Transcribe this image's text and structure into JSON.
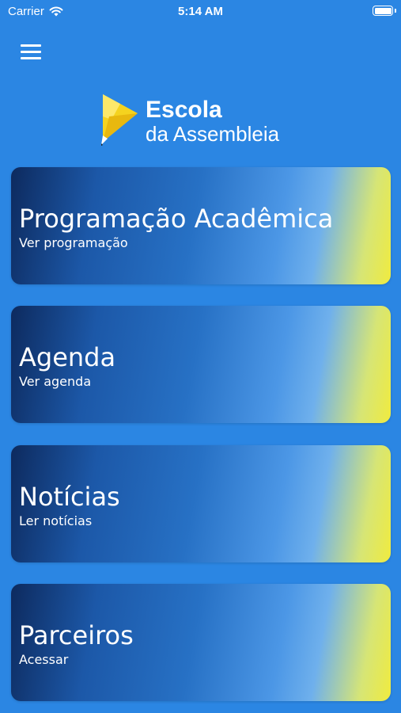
{
  "status_bar": {
    "carrier": "Carrier",
    "time": "5:14 AM",
    "battery_level": 1.0
  },
  "header": {
    "menu_icon": "hamburger-menu-icon"
  },
  "logo": {
    "line1": "Escola",
    "line2": "da Assembleia",
    "colors": {
      "mark_yellow": "#f5d31f",
      "mark_white": "#ffffff"
    }
  },
  "theme": {
    "background": "#2b86e3",
    "card_gradient_start": "#0d2a5e",
    "card_gradient_end": "#f0eb3f"
  },
  "cards": [
    {
      "title": "Programação Acadêmica",
      "subtitle": "Ver programação"
    },
    {
      "title": "Agenda",
      "subtitle": "Ver agenda"
    },
    {
      "title": "Notícias",
      "subtitle": "Ler notícias"
    },
    {
      "title": "Parceiros",
      "subtitle": "Acessar"
    }
  ]
}
